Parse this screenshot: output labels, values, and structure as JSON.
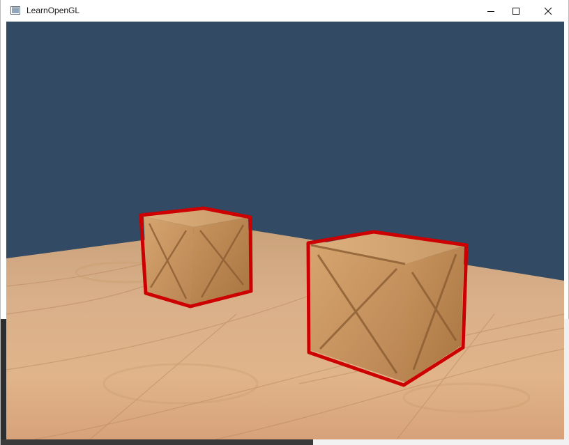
{
  "window": {
    "title": "LearnOpenGL",
    "app_icon": "opengl-window-icon",
    "controls": {
      "minimize_icon": "minimize-icon",
      "maximize_icon": "maximize-icon",
      "close_icon": "close-icon"
    }
  },
  "scene": {
    "clear_color": "#324a63",
    "floor_color": "#d6a878",
    "outline_color": "#cc0000",
    "crate_color": "#c9965e",
    "objects": [
      "crate-left",
      "crate-right",
      "wooden-floor"
    ]
  }
}
